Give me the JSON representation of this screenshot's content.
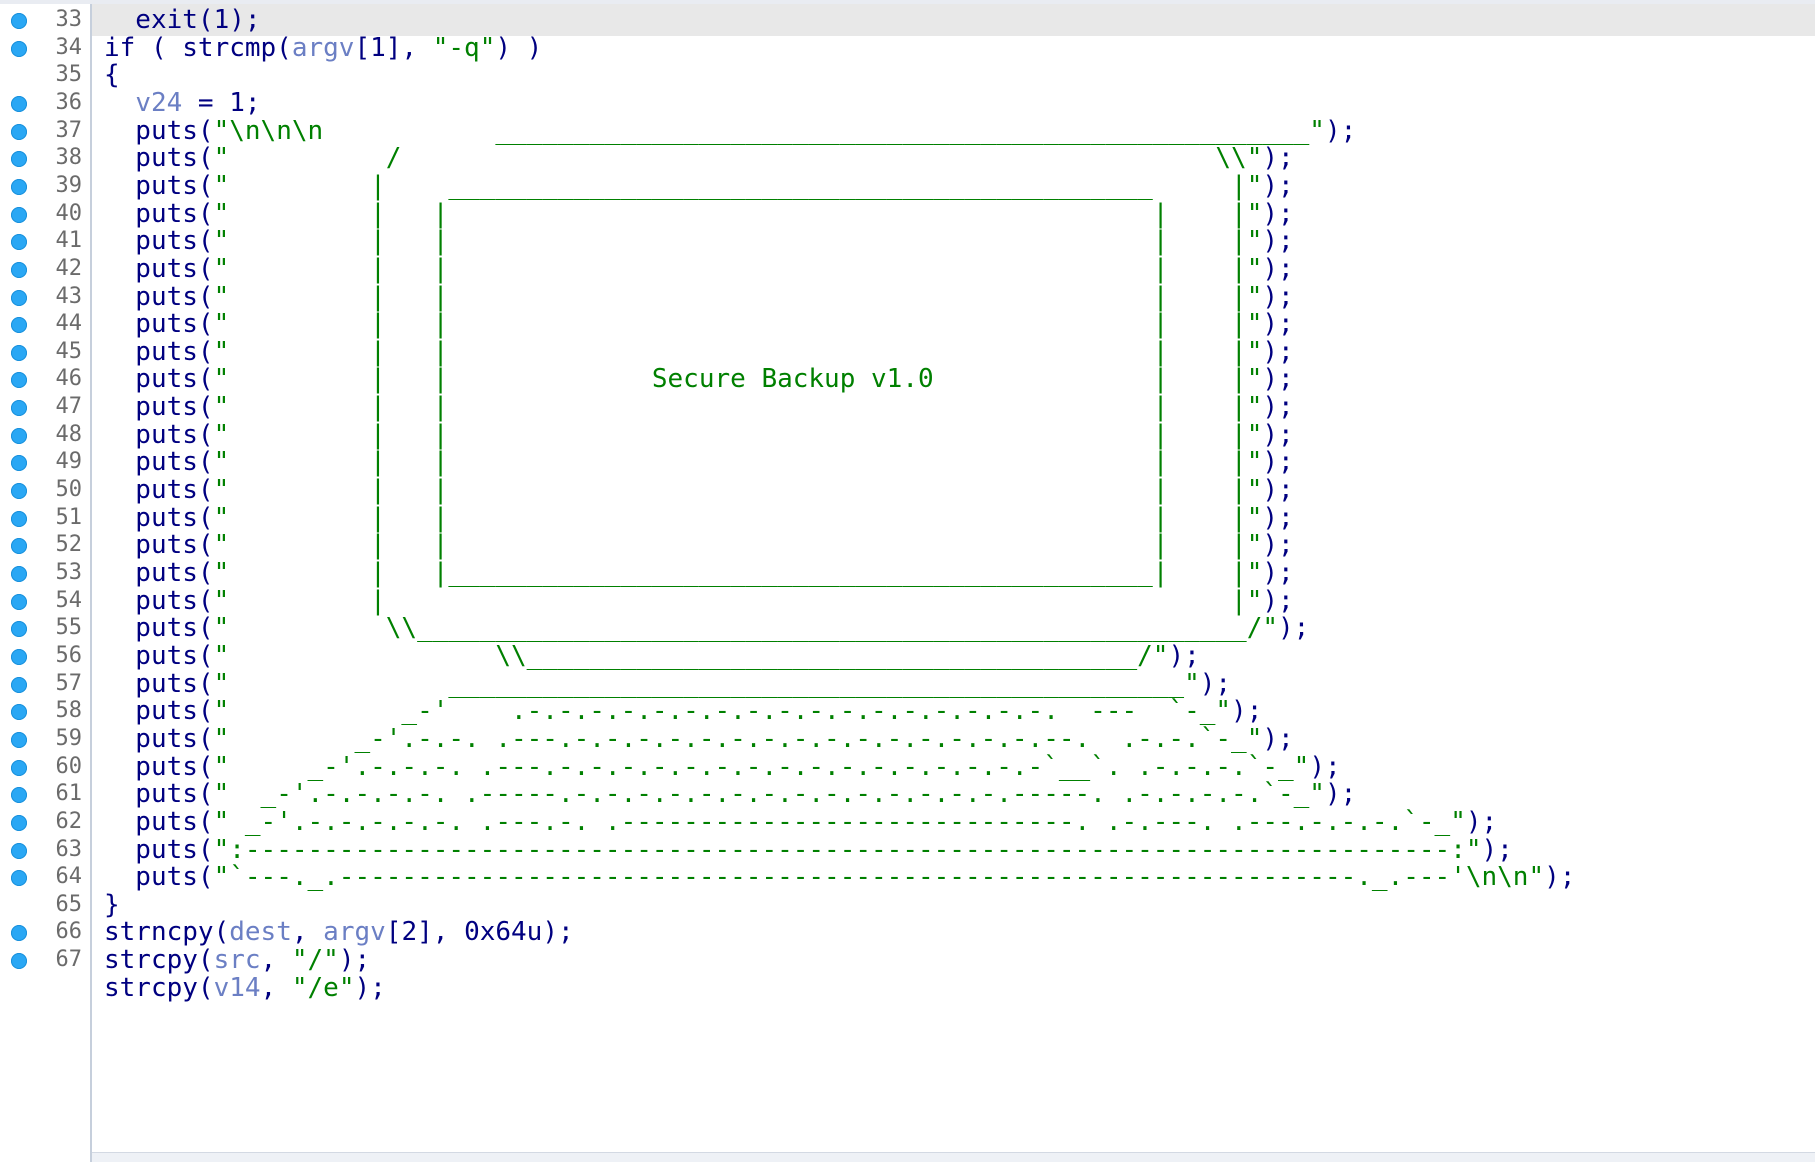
{
  "window": {
    "breakpoint_color": "#2aa7f4",
    "code_color": "#000080",
    "string_color": "#008000",
    "variable_color": "#6b7fc4"
  },
  "lines": [
    {
      "num": "33",
      "bp": true,
      "current": true,
      "segs": [
        {
          "c": "pl",
          "t": "  exit(1);"
        }
      ]
    },
    {
      "num": "34",
      "bp": true,
      "segs": [
        {
          "c": "pl",
          "t": "if ( strcmp("
        },
        {
          "c": "var",
          "t": "argv"
        },
        {
          "c": "pl",
          "t": "[1], "
        },
        {
          "c": "str",
          "t": "\"-q\""
        },
        {
          "c": "pl",
          "t": ") )"
        }
      ]
    },
    {
      "num": "35",
      "bp": false,
      "segs": [
        {
          "c": "pl",
          "t": "{"
        }
      ]
    },
    {
      "num": "36",
      "bp": true,
      "segs": [
        {
          "c": "pl",
          "t": "  "
        },
        {
          "c": "var",
          "t": "v24"
        },
        {
          "c": "pl",
          "t": " = 1;"
        }
      ]
    },
    {
      "num": "37",
      "bp": true,
      "segs": [
        {
          "c": "pl",
          "t": "  puts("
        },
        {
          "c": "str",
          "t": "\"\\n\\n\\n           ____________________________________________________\""
        },
        {
          "c": "pl",
          "t": ");"
        }
      ]
    },
    {
      "num": "38",
      "bp": true,
      "segs": [
        {
          "c": "pl",
          "t": "  puts("
        },
        {
          "c": "str",
          "t": "\"          /                                                    \\\\\""
        },
        {
          "c": "pl",
          "t": ");"
        }
      ]
    },
    {
      "num": "39",
      "bp": true,
      "segs": [
        {
          "c": "pl",
          "t": "  puts("
        },
        {
          "c": "str",
          "t": "\"         |    _____________________________________________     |\""
        },
        {
          "c": "pl",
          "t": ");"
        }
      ]
    },
    {
      "num": "40",
      "bp": true,
      "segs": [
        {
          "c": "pl",
          "t": "  puts("
        },
        {
          "c": "str",
          "t": "\"         |   |                                             |    |\""
        },
        {
          "c": "pl",
          "t": ");"
        }
      ]
    },
    {
      "num": "41",
      "bp": true,
      "segs": [
        {
          "c": "pl",
          "t": "  puts("
        },
        {
          "c": "str",
          "t": "\"         |   |                                             |    |\""
        },
        {
          "c": "pl",
          "t": ");"
        }
      ]
    },
    {
      "num": "42",
      "bp": true,
      "segs": [
        {
          "c": "pl",
          "t": "  puts("
        },
        {
          "c": "str",
          "t": "\"         |   |                                             |    |\""
        },
        {
          "c": "pl",
          "t": ");"
        }
      ]
    },
    {
      "num": "43",
      "bp": true,
      "segs": [
        {
          "c": "pl",
          "t": "  puts("
        },
        {
          "c": "str",
          "t": "\"         |   |                                             |    |\""
        },
        {
          "c": "pl",
          "t": ");"
        }
      ]
    },
    {
      "num": "44",
      "bp": true,
      "segs": [
        {
          "c": "pl",
          "t": "  puts("
        },
        {
          "c": "str",
          "t": "\"         |   |                                             |    |\""
        },
        {
          "c": "pl",
          "t": ");"
        }
      ]
    },
    {
      "num": "45",
      "bp": true,
      "segs": [
        {
          "c": "pl",
          "t": "  puts("
        },
        {
          "c": "str",
          "t": "\"         |   |                                             |    |\""
        },
        {
          "c": "pl",
          "t": ");"
        }
      ]
    },
    {
      "num": "46",
      "bp": true,
      "segs": [
        {
          "c": "pl",
          "t": "  puts("
        },
        {
          "c": "str",
          "t": "\"         |   |             Secure Backup v1.0              |    |\""
        },
        {
          "c": "pl",
          "t": ");"
        }
      ]
    },
    {
      "num": "47",
      "bp": true,
      "segs": [
        {
          "c": "pl",
          "t": "  puts("
        },
        {
          "c": "str",
          "t": "\"         |   |                                             |    |\""
        },
        {
          "c": "pl",
          "t": ");"
        }
      ]
    },
    {
      "num": "48",
      "bp": true,
      "segs": [
        {
          "c": "pl",
          "t": "  puts("
        },
        {
          "c": "str",
          "t": "\"         |   |                                             |    |\""
        },
        {
          "c": "pl",
          "t": ");"
        }
      ]
    },
    {
      "num": "49",
      "bp": true,
      "segs": [
        {
          "c": "pl",
          "t": "  puts("
        },
        {
          "c": "str",
          "t": "\"         |   |                                             |    |\""
        },
        {
          "c": "pl",
          "t": ");"
        }
      ]
    },
    {
      "num": "50",
      "bp": true,
      "segs": [
        {
          "c": "pl",
          "t": "  puts("
        },
        {
          "c": "str",
          "t": "\"         |   |                                             |    |\""
        },
        {
          "c": "pl",
          "t": ");"
        }
      ]
    },
    {
      "num": "51",
      "bp": true,
      "segs": [
        {
          "c": "pl",
          "t": "  puts("
        },
        {
          "c": "str",
          "t": "\"         |   |                                             |    |\""
        },
        {
          "c": "pl",
          "t": ");"
        }
      ]
    },
    {
      "num": "52",
      "bp": true,
      "segs": [
        {
          "c": "pl",
          "t": "  puts("
        },
        {
          "c": "str",
          "t": "\"         |   |                                             |    |\""
        },
        {
          "c": "pl",
          "t": ");"
        }
      ]
    },
    {
      "num": "53",
      "bp": true,
      "segs": [
        {
          "c": "pl",
          "t": "  puts("
        },
        {
          "c": "str",
          "t": "\"         |   |_____________________________________________|    |\""
        },
        {
          "c": "pl",
          "t": ");"
        }
      ]
    },
    {
      "num": "54",
      "bp": true,
      "segs": [
        {
          "c": "pl",
          "t": "  puts("
        },
        {
          "c": "str",
          "t": "\"         |                                                      |\""
        },
        {
          "c": "pl",
          "t": ");"
        }
      ]
    },
    {
      "num": "55",
      "bp": true,
      "segs": [
        {
          "c": "pl",
          "t": "  puts("
        },
        {
          "c": "str",
          "t": "\"          \\\\_____________________________________________________/\""
        },
        {
          "c": "pl",
          "t": ");"
        }
      ]
    },
    {
      "num": "56",
      "bp": true,
      "segs": [
        {
          "c": "pl",
          "t": "  puts("
        },
        {
          "c": "str",
          "t": "\"                 \\\\_______________________________________/\""
        },
        {
          "c": "pl",
          "t": ");"
        }
      ]
    },
    {
      "num": "57",
      "bp": true,
      "segs": [
        {
          "c": "pl",
          "t": "  puts("
        },
        {
          "c": "str",
          "t": "\"              _______________________________________________\""
        },
        {
          "c": "pl",
          "t": ");"
        }
      ]
    },
    {
      "num": "58",
      "bp": true,
      "segs": [
        {
          "c": "pl",
          "t": "  puts("
        },
        {
          "c": "str",
          "t": "\"           _-'    .-.-.-.-.-.-.-.-.-.-.-.-.-.-.-.-.-.  ---  `-_\""
        },
        {
          "c": "pl",
          "t": ");"
        }
      ]
    },
    {
      "num": "59",
      "bp": true,
      "segs": [
        {
          "c": "pl",
          "t": "  puts("
        },
        {
          "c": "str",
          "t": "\"        _-'.-.-. .---.-.-.-.-.-.-.-.-.-.-.-.-.-.-.-.--.  .-.-.`-_\""
        },
        {
          "c": "pl",
          "t": ");"
        }
      ]
    },
    {
      "num": "60",
      "bp": true,
      "segs": [
        {
          "c": "pl",
          "t": "  puts("
        },
        {
          "c": "str",
          "t": "\"     _-'.-.-.-. .---.-.-.-.-.-.-.-.-.-.-.-.-.-.-.-.-`__`. .-.-.-.`-_\""
        },
        {
          "c": "pl",
          "t": ");"
        }
      ]
    },
    {
      "num": "61",
      "bp": true,
      "segs": [
        {
          "c": "pl",
          "t": "  puts("
        },
        {
          "c": "str",
          "t": "\"  _-'.-.-.-.-. .-----.-.-.-.-.-.-.-.-.-.-.-.-.-.-.-----. .-.-.-.-.`-_\""
        },
        {
          "c": "pl",
          "t": ");"
        }
      ]
    },
    {
      "num": "62",
      "bp": true,
      "segs": [
        {
          "c": "pl",
          "t": "  puts("
        },
        {
          "c": "str",
          "t": "\" _-'.-.-.-.-.-. .---.-. .-----------------------------. .-.---. .---.-.-.-.`-_\""
        },
        {
          "c": "pl",
          "t": ");"
        }
      ]
    },
    {
      "num": "63",
      "bp": true,
      "segs": [
        {
          "c": "pl",
          "t": "  puts("
        },
        {
          "c": "str",
          "t": "\":-----------------------------------------------------------------------------:\""
        },
        {
          "c": "pl",
          "t": ");"
        }
      ]
    },
    {
      "num": "64",
      "bp": true,
      "segs": [
        {
          "c": "pl",
          "t": "  puts("
        },
        {
          "c": "str",
          "t": "\"`---._.-----------------------------------------------------------------._.---'\\n\\n\""
        },
        {
          "c": "pl",
          "t": ");"
        }
      ]
    },
    {
      "num": "65",
      "bp": false,
      "segs": [
        {
          "c": "pl",
          "t": "}"
        }
      ]
    },
    {
      "num": "66",
      "bp": true,
      "segs": [
        {
          "c": "pl",
          "t": "strncpy("
        },
        {
          "c": "var",
          "t": "dest"
        },
        {
          "c": "pl",
          "t": ", "
        },
        {
          "c": "var",
          "t": "argv"
        },
        {
          "c": "pl",
          "t": "[2], 0x64u);"
        }
      ]
    },
    {
      "num": "67",
      "bp": true,
      "segs": [
        {
          "c": "pl",
          "t": "strcpy("
        },
        {
          "c": "var",
          "t": "src"
        },
        {
          "c": "pl",
          "t": ", "
        },
        {
          "c": "str",
          "t": "\"/\""
        },
        {
          "c": "pl",
          "t": ");"
        }
      ]
    },
    {
      "num": "",
      "bp": false,
      "segs": [
        {
          "c": "pl",
          "t": "strcpy("
        },
        {
          "c": "var",
          "t": "v14"
        },
        {
          "c": "pl",
          "t": ", "
        },
        {
          "c": "str",
          "t": "\"/e\""
        },
        {
          "c": "pl",
          "t": ");"
        }
      ]
    }
  ]
}
